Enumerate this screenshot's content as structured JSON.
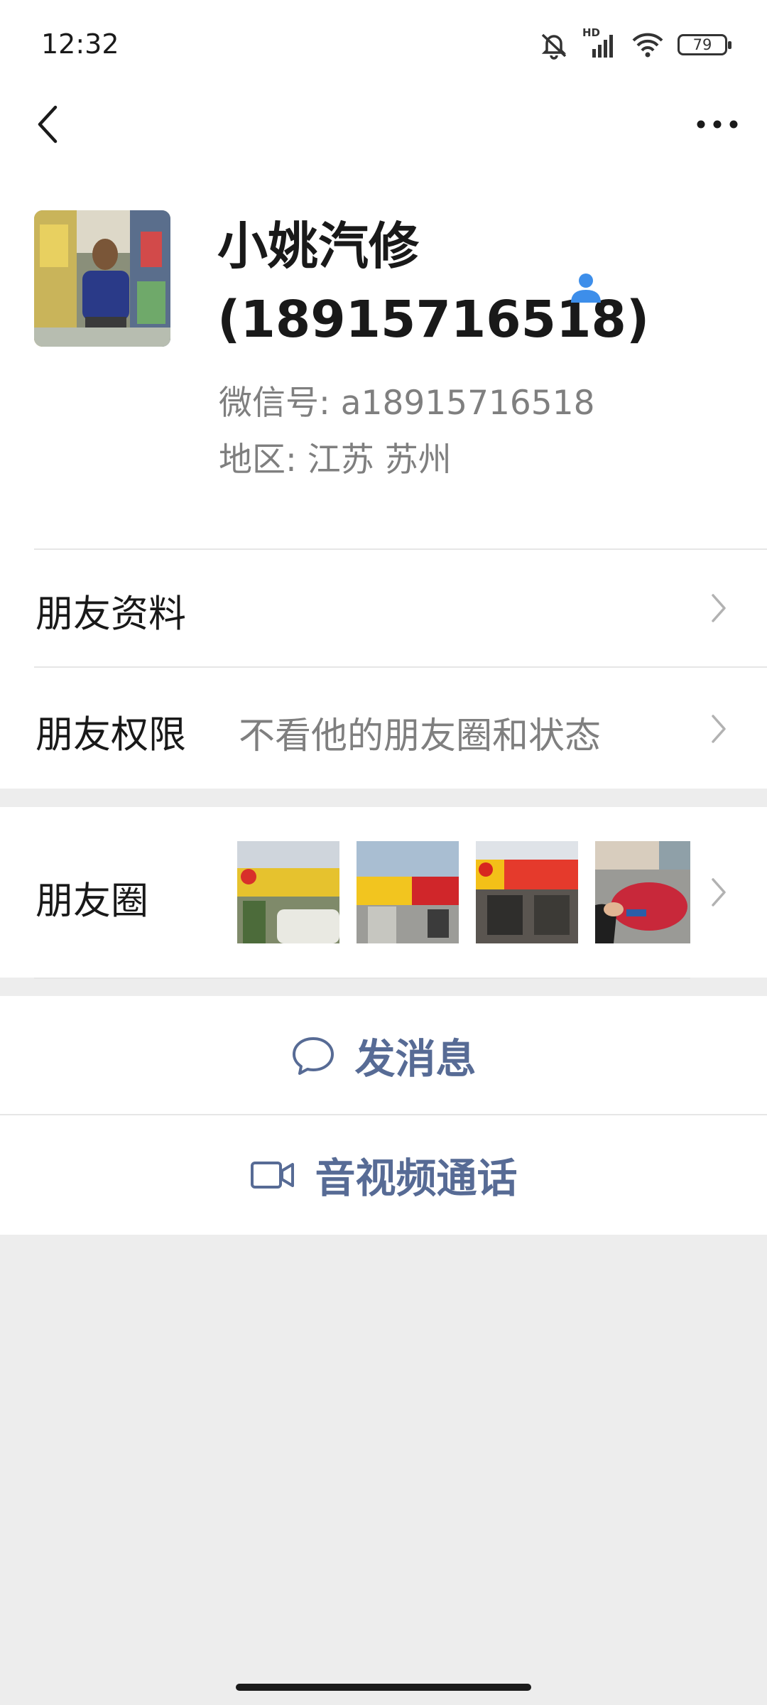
{
  "status_bar": {
    "time": "12:32",
    "network": "HD",
    "battery": "79"
  },
  "profile": {
    "name": "小姚汽修(18915716518)",
    "wechat_id": "微信号:  a18915716518",
    "region": "地区:  江苏  苏州"
  },
  "rows": {
    "friend_info": {
      "label": "朋友资料"
    },
    "friend_permissions": {
      "label": "朋友权限",
      "value": "不看他的朋友圈和状态"
    },
    "moments": {
      "label": "朋友圈"
    }
  },
  "actions": {
    "send_message": "发消息",
    "video_call": "音视频通话"
  },
  "colors": {
    "link_blue": "#576b95",
    "badge_blue": "#3d8eea",
    "page_bg": "#ededed"
  }
}
